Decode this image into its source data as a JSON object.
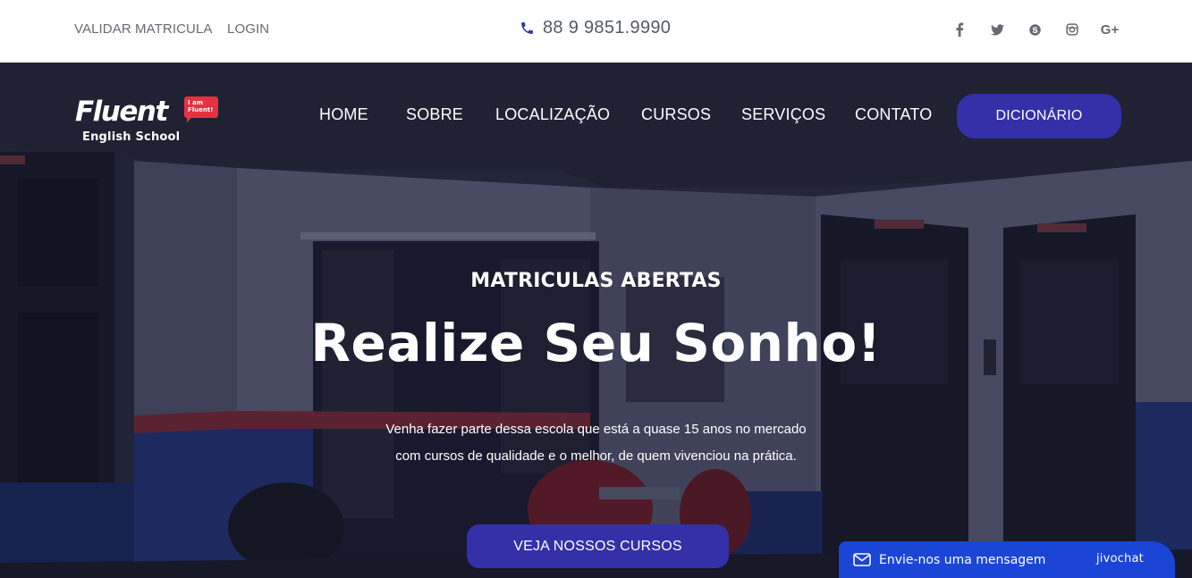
{
  "topbar": {
    "validate_label": "VALIDAR MATRICULA",
    "login_label": "LOGIN",
    "phone": "88 9 9851.9990",
    "socials": [
      "facebook-icon",
      "twitter-icon",
      "skype-icon",
      "instagram-icon",
      "google-plus-icon"
    ],
    "google_plus_text": "G+"
  },
  "logo": {
    "word": "Fluent",
    "subtitle": "English School",
    "tag": "I am Fluent!"
  },
  "nav": {
    "items": [
      "HOME",
      "SOBRE",
      "LOCALIZAÇÃO",
      "CURSOS",
      "SERVIÇOS",
      "CONTATO"
    ],
    "cta": "DICIONÁRIO"
  },
  "hero": {
    "eyebrow": "MATRICULAS ABERTAS",
    "headline": "Realize Seu Sonho!",
    "description_lines": [
      "Venha fazer parte dessa escola que está a quase 15 anos no mercado",
      "com cursos de qualidade e o melhor, de quem vivenciou na prática."
    ],
    "button": "VEJA NOSSOS CURSOS"
  },
  "chat": {
    "label": "Envie-nos uma mensagem",
    "brand": "jivochat"
  },
  "colors": {
    "accent": "#3330a8",
    "chat_blue": "#1a45d6",
    "logo_red": "#e23340"
  }
}
